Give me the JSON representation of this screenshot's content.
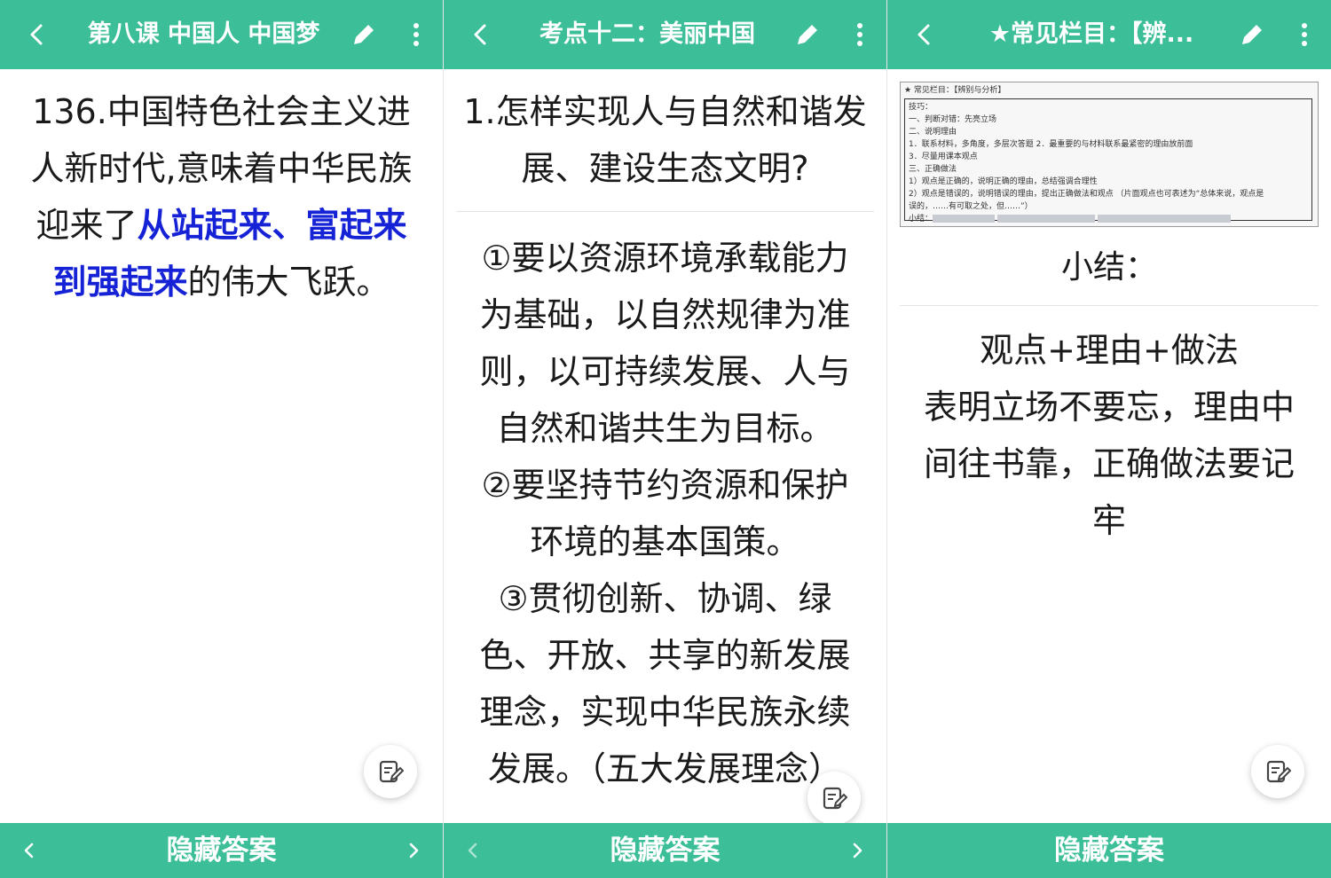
{
  "colors": {
    "accent": "#3cbf98",
    "highlight": "#1522d6",
    "text": "#1a1a1a"
  },
  "icons": {
    "back": "chevron-left-icon",
    "edit": "pencil-icon",
    "more": "more-vertical-icon",
    "note": "note-edit-icon",
    "prev": "chevron-left-icon",
    "next": "chevron-right-icon"
  },
  "screen1": {
    "title": "第八课 中国人 中国梦",
    "question": {
      "pre": "136.中国特色社会主义进人新时代,意味着中华民族迎来了",
      "highlight": "从站起来、富起来到强起来",
      "post": "的伟大飞跃。"
    },
    "bottom_label": "隐藏答案"
  },
  "screen2": {
    "title": "考点十二：美丽中国",
    "question": "1.怎样实现人与自然和谐发展、建设生态文明?",
    "answers": [
      "①要以资源环境承载能力为基础，以自然规律为准则，以可持续发展、人与自然和谐共生为目标。",
      "②要坚持节约资源和保护环境的基本国策。",
      "③贯彻创新、协调、绿色、开放、共享的新发展理念，实现中华民族永续发展。（五大发展理念）"
    ],
    "bottom_label": "隐藏答案"
  },
  "screen3": {
    "title": "★常见栏目：【辨...",
    "doc": {
      "heading": "★ 常见栏目：【辨别与分析】",
      "lines": [
        "技巧：",
        "一、判断对错：先亮立场",
        "二、说明理由",
        "1．联系材料，多角度，多层次答题    2．最重要的与材料联系最紧密的理由放前面",
        "3．尽量用课本观点",
        "三、正确做法",
        "1）观点是正确的，说明正确的理由，总结强调合理性",
        "2）观点是错误的，说明错误的理由，提出正确做法和观点  （片面观点也可表述为“总体来说，观点是",
        "误的，……有可取之处，但……”）"
      ],
      "summary_label": "小结："
    },
    "summary_title": "小结：",
    "answer_lines": [
      "观点+理由+做法",
      "表明立场不要忘，理由中间往书靠，正确做法要记牢"
    ],
    "bottom_label": "隐藏答案"
  }
}
